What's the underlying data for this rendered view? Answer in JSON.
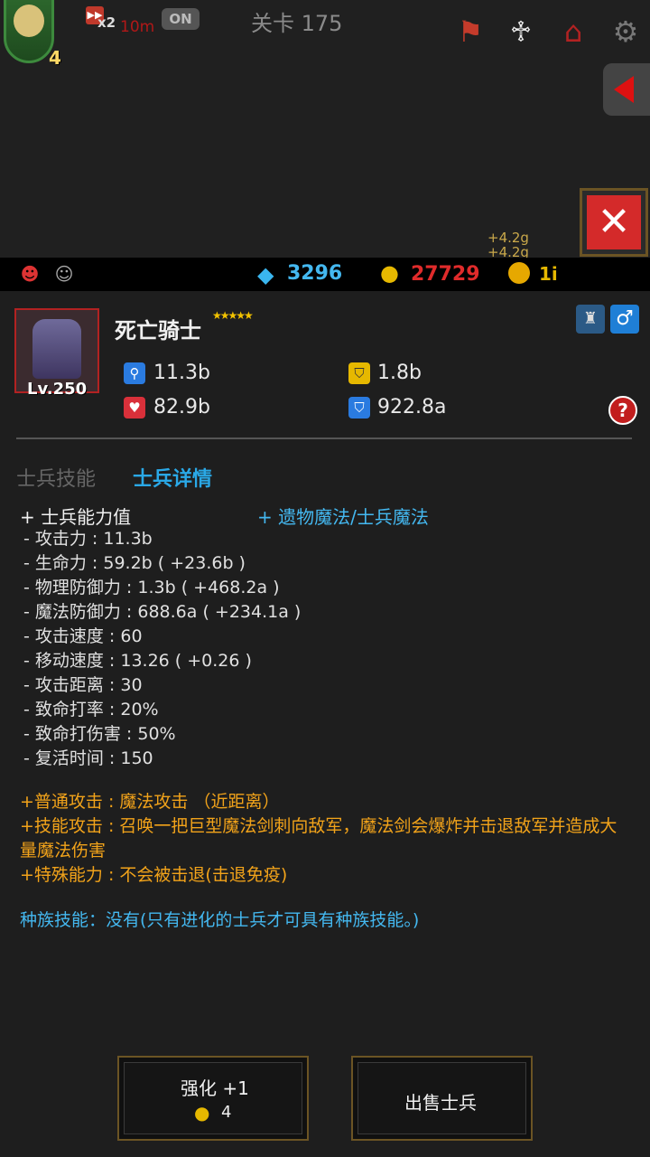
{
  "hud": {
    "avatar_level": "4",
    "speed_multiplier": "x2",
    "speed_time": "10m",
    "auto_toggle": "ON",
    "stage": "关卡 175",
    "floating_gold": [
      "+4.2g",
      "+4.2g"
    ]
  },
  "resources": {
    "gems": "3296",
    "medals": "27729",
    "gold": "1i"
  },
  "unit": {
    "name": "死亡骑士",
    "stars": "★★★★★",
    "level": "Lv.250",
    "attack": "11.3b",
    "hp": "82.9b",
    "phys_def": "1.8b",
    "magic_def": "922.8a"
  },
  "tabs": {
    "skills": "士兵技能",
    "details": "士兵详情"
  },
  "details": {
    "stats_heading": "+ 士兵能力值",
    "relic_link": "+ 遗物魔法/士兵魔法",
    "stats": [
      "- 攻击力 : 11.3b",
      "- 生命力 : 59.2b ( +23.6b )",
      "- 物理防御力 : 1.3b ( +468.2a )",
      "- 魔法防御力 : 688.6a ( +234.1a )",
      "- 攻击速度 : 60",
      "- 移动速度 : 13.26 ( +0.26 )",
      "- 攻击距离 : 30",
      "- 致命打率 : 20%",
      "- 致命打伤害 : 50%",
      "- 复活时间 : 150"
    ],
    "abilities": [
      "+普通攻击 : 魔法攻击 （近距离）",
      "+技能攻击 : 召唤一把巨型魔法剑刺向敌军，魔法剑会爆炸并击退敌军并造成大量魔法伤害",
      "+特殊能力 : 不会被击退(击退免疫)"
    ],
    "race_skill": "种族技能：没有(只有进化的士兵才可具有种族技能。)"
  },
  "buttons": {
    "upgrade_label": "强化 +1",
    "upgrade_cost": "4",
    "sell_label": "出售士兵"
  },
  "icons": {
    "gem": "gem-icon",
    "medal": "medal-icon",
    "coin": "coin-icon",
    "settings": "gear-icon",
    "close": "close-icon"
  },
  "colors": {
    "accent_blue": "#44b8f0",
    "accent_orange": "#f2a31a",
    "danger_red": "#d42a2a"
  }
}
